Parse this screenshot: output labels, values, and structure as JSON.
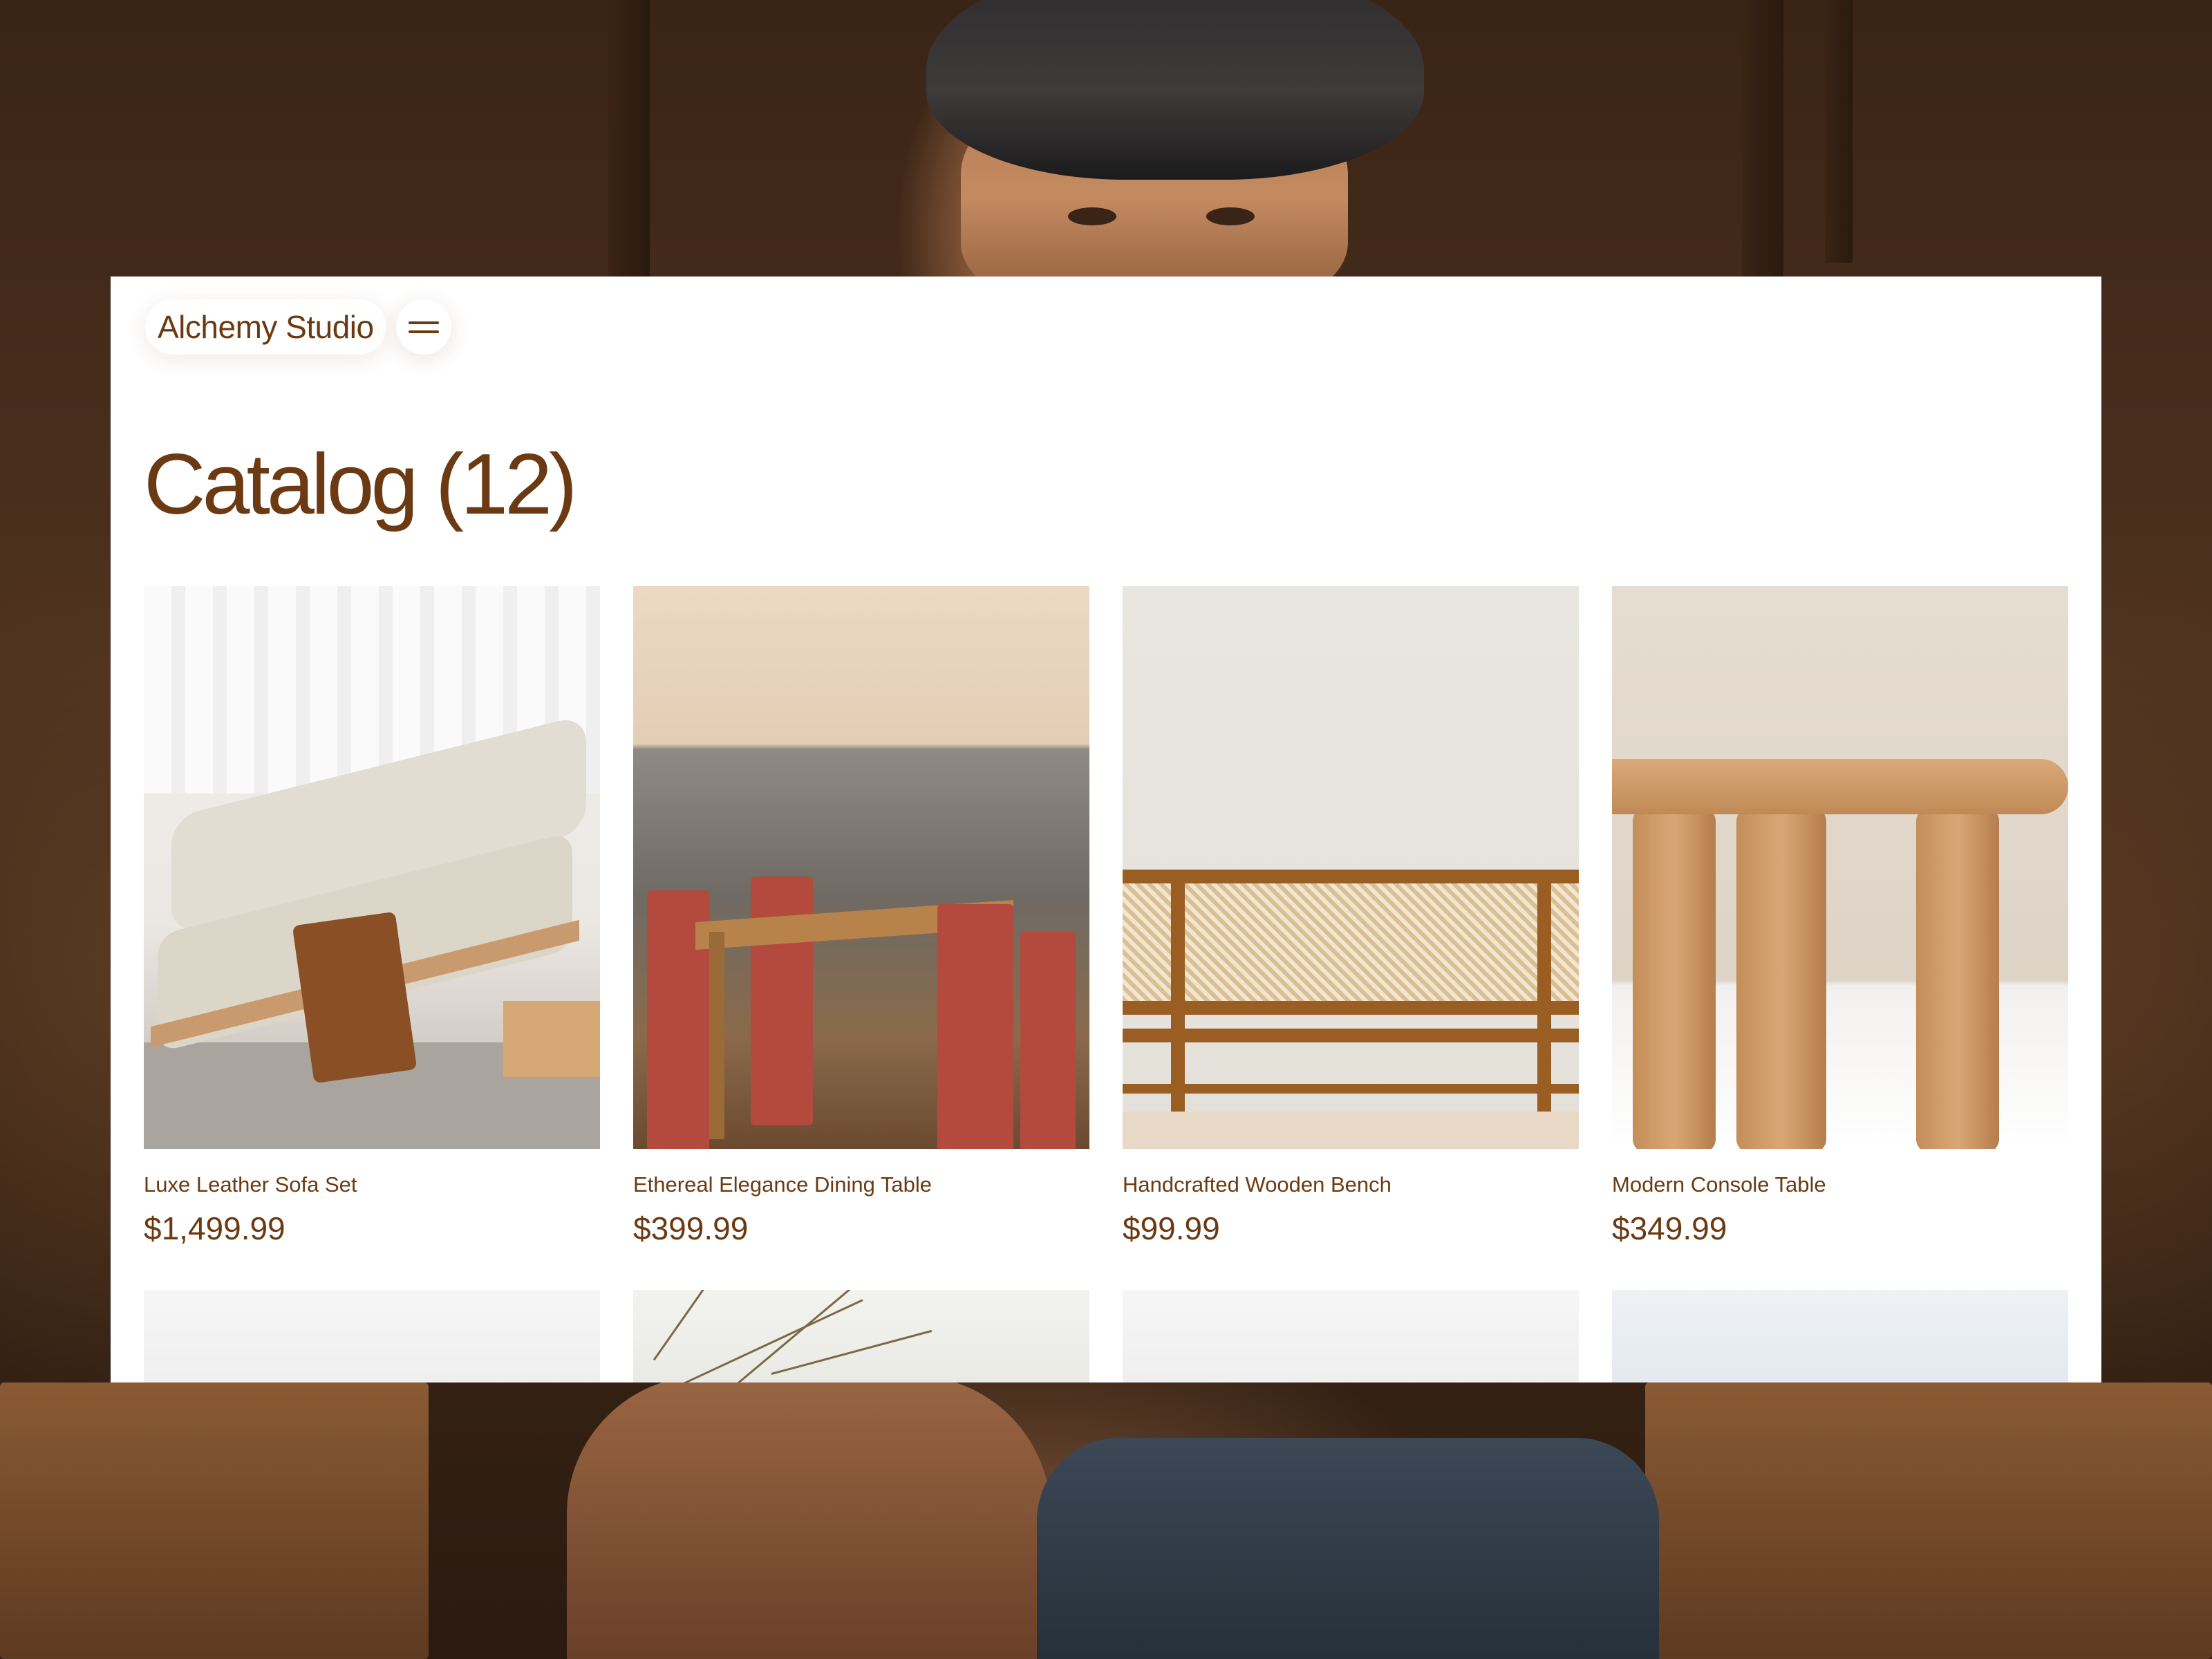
{
  "brand": {
    "name": "Alchemy Studio"
  },
  "menu": {
    "icon": "hamburger-menu-icon"
  },
  "catalog": {
    "title": "Catalog (12)"
  },
  "products": [
    {
      "name": "Luxe Leather Sofa Set",
      "price": "$1,499.99"
    },
    {
      "name": "Ethereal Elegance Dining Table",
      "price": "$399.99"
    },
    {
      "name": "Handcrafted Wooden Bench",
      "price": "$99.99"
    },
    {
      "name": "Modern Console Table",
      "price": "$349.99"
    }
  ],
  "colors": {
    "accent": "#6b3a12",
    "panel": "#ffffff"
  }
}
